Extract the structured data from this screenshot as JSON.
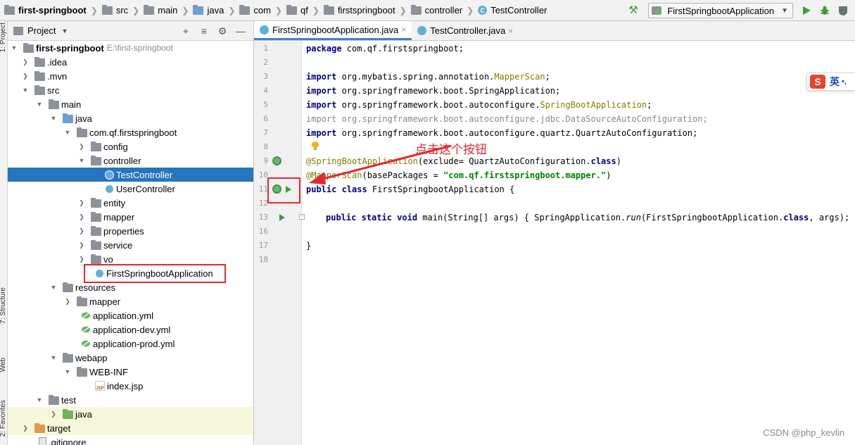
{
  "navbar": {
    "crumbs": [
      {
        "label": "first-springboot",
        "bold": true,
        "icon": "folder-icon"
      },
      {
        "label": "src",
        "icon": "folder-icon"
      },
      {
        "label": "main",
        "icon": "folder-icon"
      },
      {
        "label": "java",
        "icon": "folder-icon"
      },
      {
        "label": "com",
        "icon": "folder-icon"
      },
      {
        "label": "qf",
        "icon": "folder-icon"
      },
      {
        "label": "firstspringboot",
        "icon": "folder-icon"
      },
      {
        "label": "controller",
        "icon": "folder-icon"
      },
      {
        "label": "TestController",
        "icon": "class-icon"
      }
    ],
    "run_config": "FirstSpringbootApplication"
  },
  "toolstrip": {
    "project_label": "1: Project",
    "structure_label": "7: Structure",
    "web_label": "Web",
    "favorites_label": "2: Favorites"
  },
  "project_panel": {
    "title": "Project",
    "root_label": "first-springboot",
    "root_path": "E:\\first-springboot",
    "items": [
      {
        "label": ".idea"
      },
      {
        "label": ".mvn"
      },
      {
        "label": "src"
      },
      {
        "label": "main"
      },
      {
        "label": "java"
      },
      {
        "label": "com.qf.firstspringboot"
      },
      {
        "label": "config"
      },
      {
        "label": "controller"
      },
      {
        "label": "TestController"
      },
      {
        "label": "UserController"
      },
      {
        "label": "entity"
      },
      {
        "label": "mapper"
      },
      {
        "label": "properties"
      },
      {
        "label": "service"
      },
      {
        "label": "vo"
      },
      {
        "label": "FirstSpringbootApplication"
      },
      {
        "label": "resources"
      },
      {
        "label": "mapper"
      },
      {
        "label": "application.yml"
      },
      {
        "label": "application-dev.yml"
      },
      {
        "label": "application-prod.yml"
      },
      {
        "label": "webapp"
      },
      {
        "label": "WEB-INF"
      },
      {
        "label": "index.jsp"
      },
      {
        "label": "test"
      },
      {
        "label": "java"
      },
      {
        "label": "target"
      },
      {
        "label": ".gitignore"
      }
    ]
  },
  "editor": {
    "tabs": [
      {
        "label": "FirstSpringbootApplication.java",
        "active": true
      },
      {
        "label": "TestController.java",
        "active": false
      }
    ],
    "close_glyph": "×",
    "line_numbers": [
      "1",
      "2",
      "3",
      "4",
      "5",
      "6",
      "7",
      "8",
      "9",
      "10",
      "11",
      "12",
      "13",
      "16",
      "17",
      "18"
    ],
    "code": {
      "l1": {
        "kw": "package",
        "rest": " com.qf.firstspringboot;"
      },
      "l3": {
        "kw": "import",
        "rest": " org.mybatis.spring.annotation.",
        "lib": "MapperScan",
        "end": ";"
      },
      "l4": {
        "kw": "import",
        "rest": " org.springframework.boot.SpringApplication;"
      },
      "l5": {
        "kw": "import",
        "rest": " org.springframework.boot.autoconfigure.",
        "lib": "SpringBootApplication",
        "end": ";"
      },
      "l6": {
        "kw": "import",
        "rest": " org.springframework.boot.autoconfigure.jdbc.DataSourceAutoConfiguration;"
      },
      "l7": {
        "kw": "import",
        "rest": " org.springframework.boot.autoconfigure.quartz.QuartzAutoConfiguration;"
      },
      "l9": {
        "ann": "@SpringBootApplication",
        "rest": "(exclude= QuartzAutoConfiguration.",
        "kw": "class",
        "end": ")"
      },
      "l10": {
        "ann": "@MapperScan",
        "rest": "(basePackages = ",
        "str": "\"com.qf.firstspringboot.mapper.\"",
        "end": ")"
      },
      "l11": {
        "kw": "public class",
        "rest": " FirstSpringbootApplication {"
      },
      "l13": {
        "kw": "public static void",
        "rest": " main(String[] args) { SpringApplication.",
        "it": "run",
        "rest2": "(FirstSpringbootApplication.",
        "kw2": "class",
        "end": ", args); }"
      },
      "l17": {
        "rest": "}"
      }
    }
  },
  "overlay": {
    "note": "点击这个按钮",
    "ime_text": "英",
    "ime_logo": "S",
    "ime_dot": "•,",
    "watermark": "CSDN @php_kevlin"
  },
  "colors": {
    "selection": "#2675bf",
    "highlight_box": "#e8262c",
    "run_green": "#3f9a3f"
  }
}
